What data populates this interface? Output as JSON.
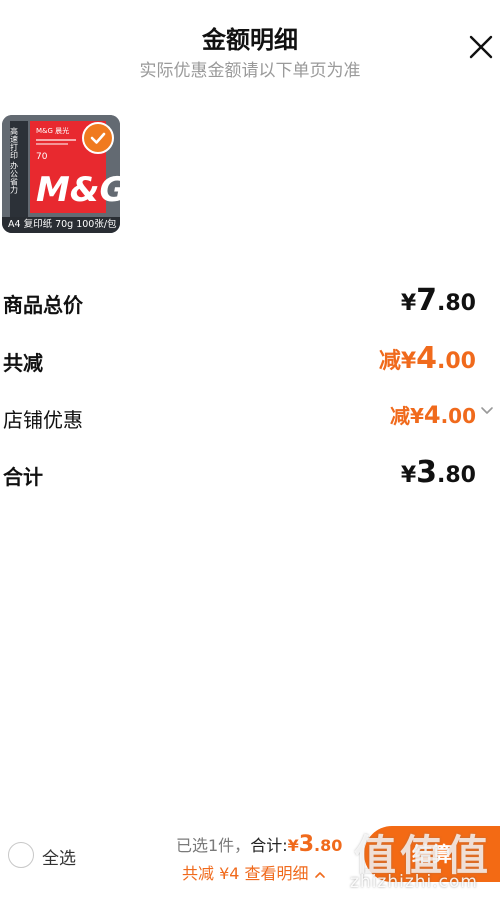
{
  "header": {
    "title": "金额明细",
    "subtitle": "实际优惠金额请以下单页为准"
  },
  "product": {
    "brand": "M&G 晨光",
    "side_text": "高速打印 办公省力",
    "weight": "70",
    "caption": "A4 复印纸 70g 100张/包"
  },
  "rows": {
    "total_price": {
      "label": "商品总价",
      "currency": "¥",
      "int": "7",
      "dec": ".80"
    },
    "total_reduce": {
      "label": "共减",
      "prefix": "减",
      "currency": "¥",
      "int": "4",
      "dec": ".00"
    },
    "store_discount": {
      "label": "店铺优惠",
      "prefix": "减",
      "currency": "¥",
      "int": "4",
      "dec": ".00"
    },
    "sum": {
      "label": "合计",
      "currency": "¥",
      "int": "3",
      "dec": ".80"
    }
  },
  "bottom_bar": {
    "select_all": "全选",
    "selected": "已选1件，",
    "sum_label": "合计:",
    "sum_currency": "¥",
    "sum_int": "3",
    "sum_dec": ".80",
    "detail": "共减 ¥4 查看明细",
    "checkout": "结算"
  },
  "watermark": {
    "logo": "值值值",
    "text": "zhizhizhi.com"
  },
  "colors": {
    "accent": "#f06a1c",
    "checkout_bg": "#f36a14",
    "subtle_text": "#9a9a9a"
  }
}
